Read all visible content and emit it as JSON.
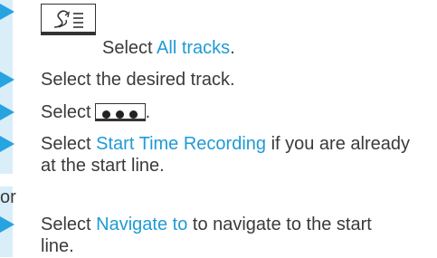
{
  "steps": [
    {
      "text_before": "Select ",
      "highlight": "All tracks",
      "text_after": "."
    },
    {
      "text": "Select the desired track."
    },
    {
      "text_before": "Select",
      "icon": "more-options-key-icon",
      "text_after": "."
    },
    {
      "line1_before": "Select ",
      "line1_highlight": "Start Time Recording",
      "line1_after": " if you are already",
      "line2": "at the start line."
    },
    {
      "line1_before": "Select ",
      "line1_highlight": "Navigate to",
      "line1_after": " to navigate to the start",
      "line2": "line."
    }
  ],
  "or_text": "or",
  "icons": {
    "route_key": "route-menu-key-icon",
    "more_key": "more-options-key-icon",
    "step_marker": "triangle-arrow-icon"
  },
  "colors": {
    "arrow": "#27a3e0",
    "bar": "#d9eef9",
    "highlight": "#1f9ad6",
    "text": "#3a3a3a"
  }
}
